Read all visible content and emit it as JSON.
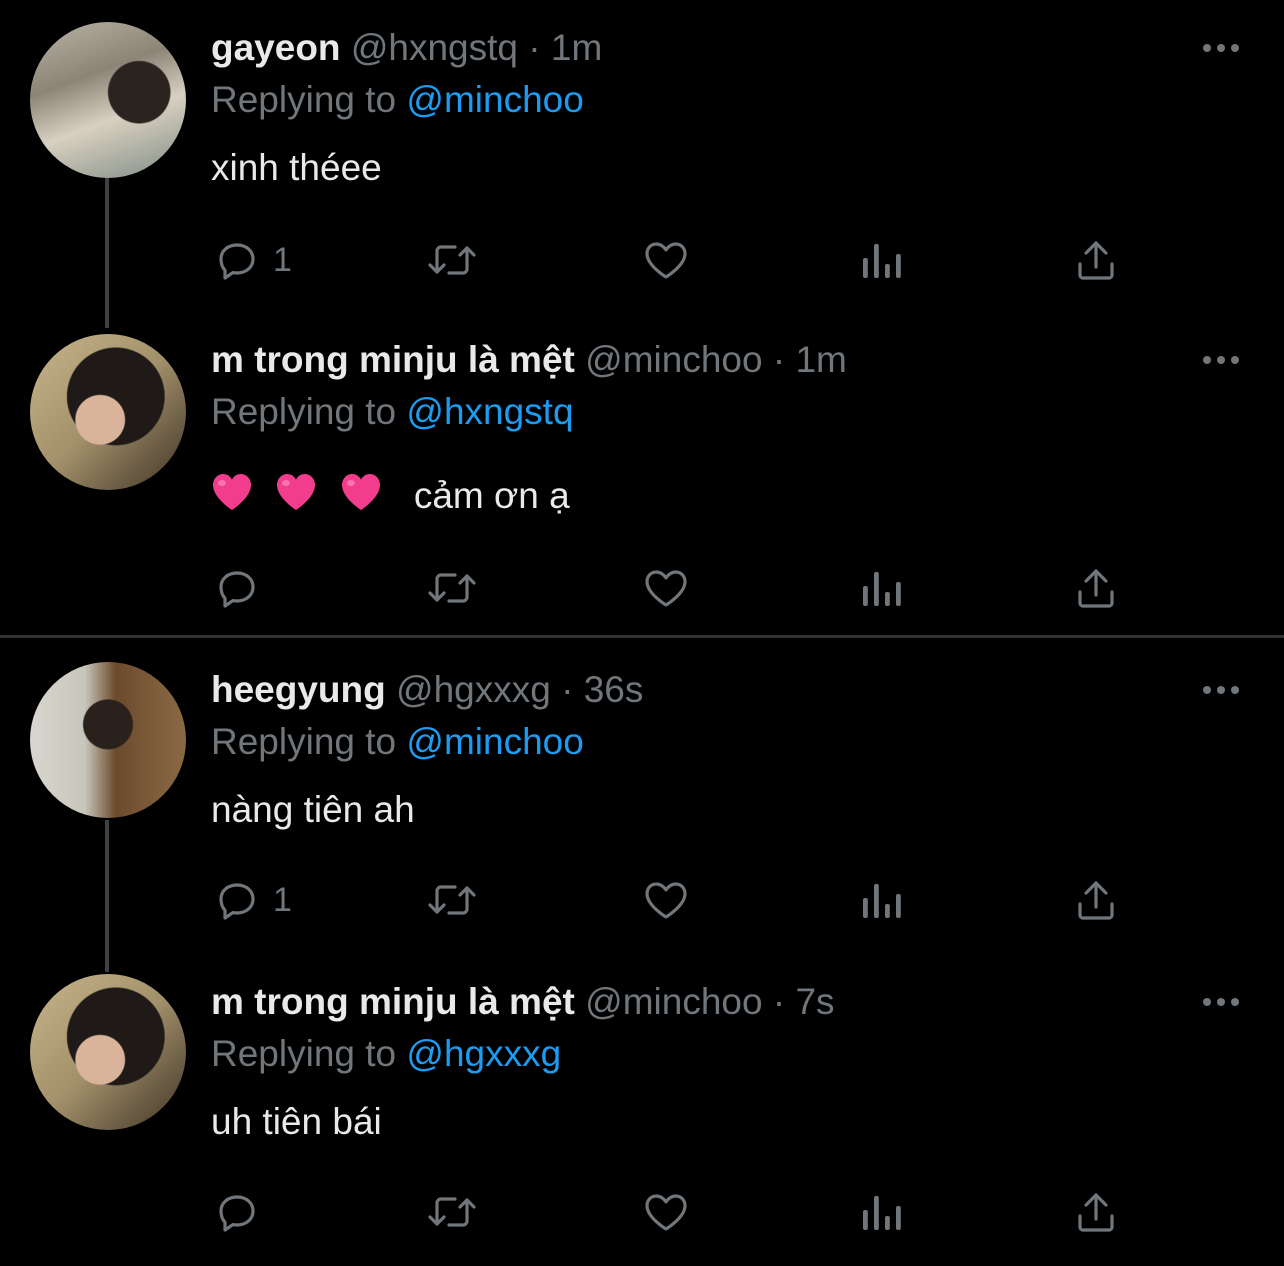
{
  "threads": [
    {
      "tweets": [
        {
          "display_name": "gayeon",
          "handle": "@hxngstq",
          "separator": "·",
          "time": "1m",
          "reply_prefix": "Replying to",
          "reply_to": "@minchoo",
          "text": "xinh théee",
          "reply_count": "1",
          "avatar": "avatar-photo-gayeon"
        },
        {
          "display_name": "m trong minju là mệt",
          "handle": "@minchoo",
          "separator": "·",
          "time": "1m",
          "reply_prefix": "Replying to",
          "reply_to": "@hxngstq",
          "emoji": [
            "💗",
            "💗",
            "💗"
          ],
          "text": "cảm ơn ạ",
          "reply_count": "",
          "avatar": "avatar-photo-minchoo"
        }
      ]
    },
    {
      "tweets": [
        {
          "display_name": "heegyung",
          "handle": "@hgxxxg",
          "separator": "·",
          "time": "36s",
          "reply_prefix": "Replying to",
          "reply_to": "@minchoo",
          "text": "nàng tiên ah",
          "reply_count": "1",
          "avatar": "avatar-photo-heegyung"
        },
        {
          "display_name": "m trong minju là mệt",
          "handle": "@minchoo",
          "separator": "·",
          "time": "7s",
          "reply_prefix": "Replying to",
          "reply_to": "@hgxxxg",
          "text": "uh tiên bái",
          "reply_count": "",
          "avatar": "avatar-photo-minchoo"
        }
      ]
    }
  ],
  "colors": {
    "background": "#000000",
    "text_primary": "#e7e9ea",
    "text_secondary": "#71767b",
    "accent": "#1d9bf0",
    "divider": "#2f3336",
    "heart_emoji": "#f23c8c"
  },
  "icons": [
    "more-icon",
    "reply-icon",
    "retweet-icon",
    "like-icon",
    "analytics-icon",
    "share-icon"
  ]
}
